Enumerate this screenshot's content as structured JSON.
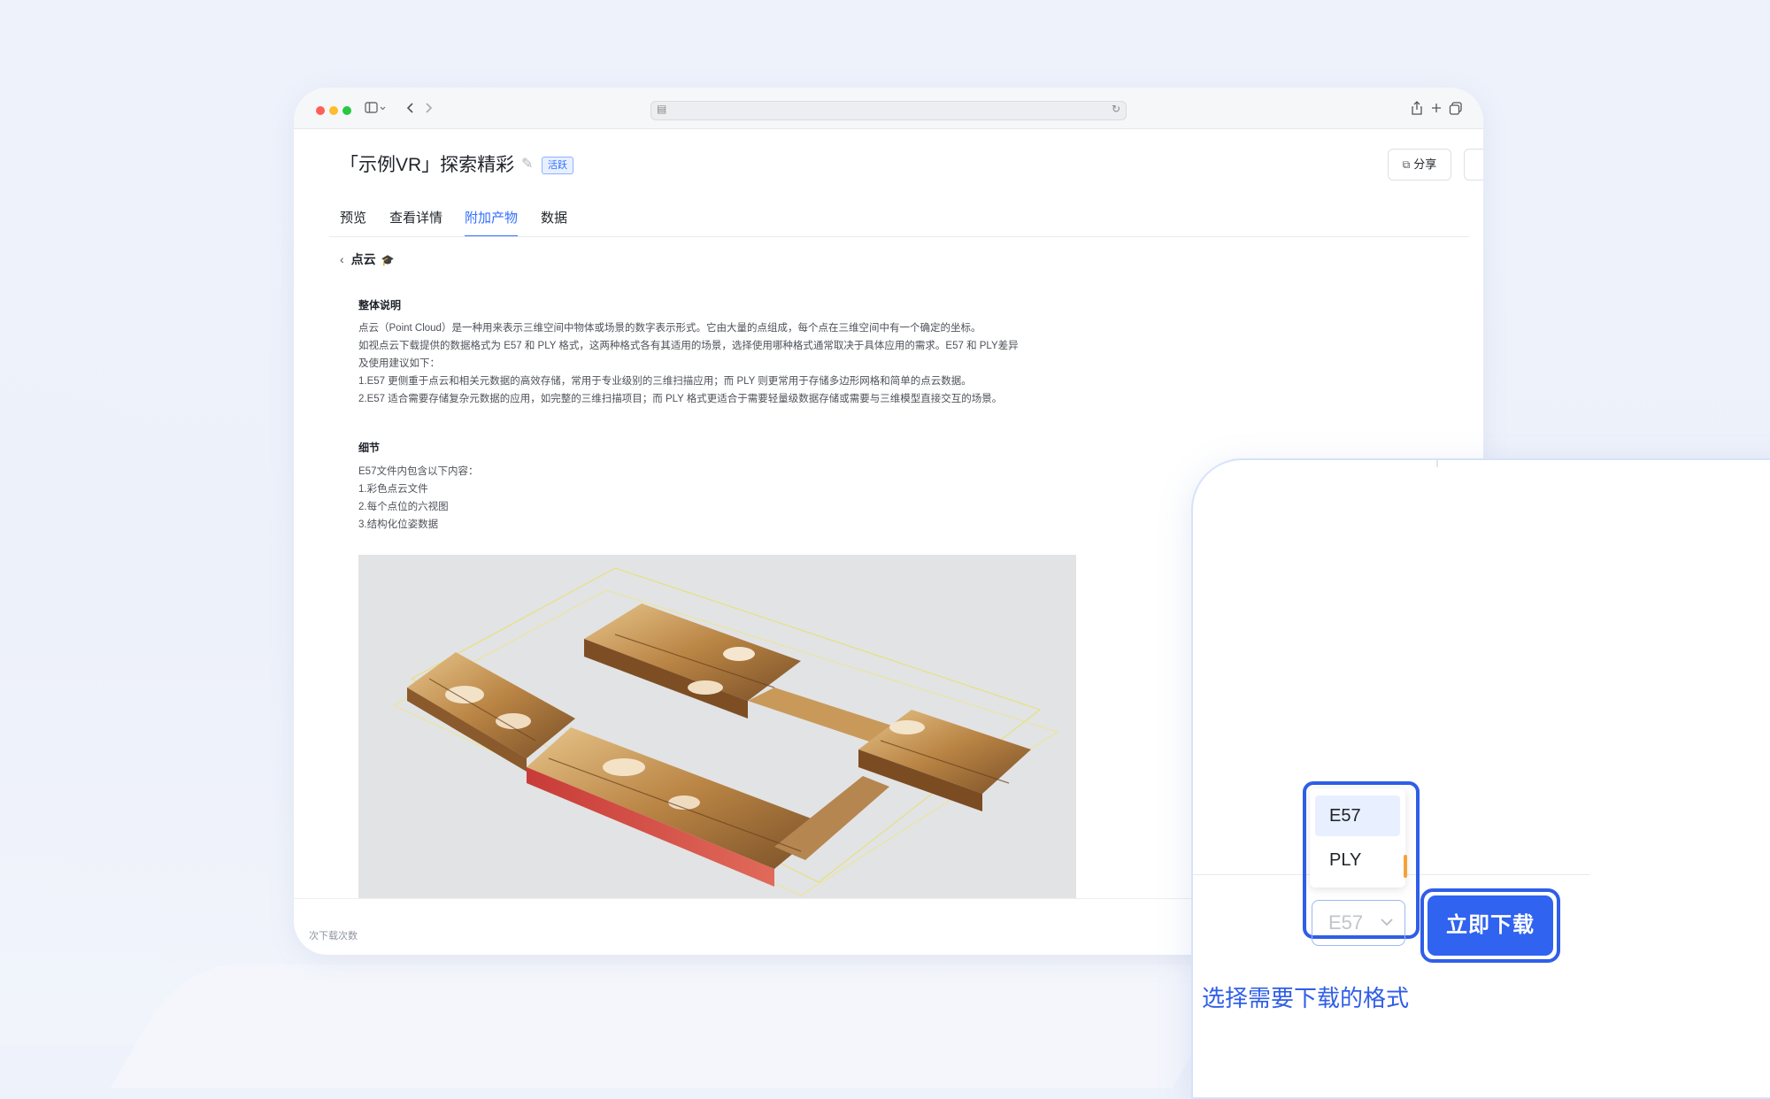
{
  "page": {
    "title": "「示例VR」探索精彩",
    "status_badge": "活跃",
    "share_label": "分享"
  },
  "tabs": [
    {
      "label": "预览"
    },
    {
      "label": "查看详情"
    },
    {
      "label": "附加产物",
      "active": true
    },
    {
      "label": "数据"
    }
  ],
  "section": {
    "title": "点云",
    "overview_heading": "整体说明",
    "overview_lines": [
      "点云（Point Cloud）是一种用来表示三维空间中物体或场景的数字表示形式。它由大量的点组成，每个点在三维空间中有一个确定的坐标。",
      "如视点云下载提供的数据格式为 E57 和 PLY 格式，这两种格式各有其适用的场景，选择使用哪种格式通常取决于具体应用的需求。E57 和 PLY差异",
      "及使用建议如下：",
      "1.E57 更侧重于点云和相关元数据的高效存储，常用于专业级别的三维扫描应用；而 PLY 则更常用于存储多边形网格和简单的点云数据。",
      "2.E57 适合需要存储复杂元数据的应用，如完整的三维扫描项目；而 PLY 格式更适合于需要轻量级数据存储或需要与三维模型直接交互的场景。"
    ],
    "detail_heading": "细节",
    "detail_lines": [
      "E57文件内包含以下内容：",
      "1.彩色点云文件",
      "2.每个点位的六视图",
      "3.结构化位姿数据"
    ]
  },
  "footer": {
    "download_count_label": "次下载次数"
  },
  "download_panel": {
    "options": [
      "E57",
      "PLY"
    ],
    "selected": "E57",
    "button_label": "立即下载",
    "caption": "选择需要下载的格式"
  },
  "colors": {
    "accent": "#3370ff",
    "highlight_frame": "#2f5ee8"
  }
}
